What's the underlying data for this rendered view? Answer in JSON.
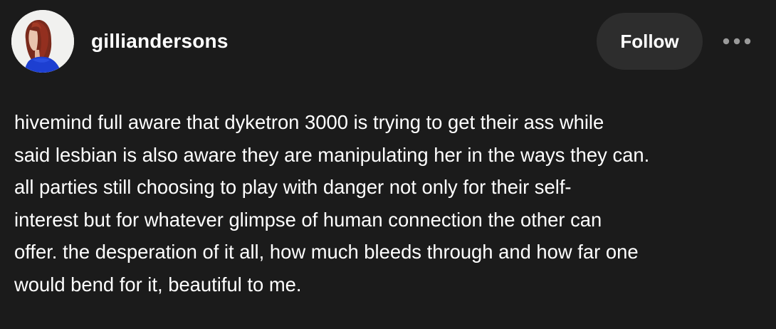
{
  "post": {
    "username": "gilliandersons",
    "follow_label": "Follow",
    "more_icon": "ellipsis-horizontal-icon",
    "avatar_icon": "profile-avatar",
    "body_lines": [
      "hivemind full aware that dyketron 3000 is trying to get their ass while",
      "said lesbian is also aware they are manipulating her in the ways they can.",
      "all parties still choosing to play with danger not only for their self-",
      "interest but for whatever glimpse of human connection the other can",
      "offer. the desperation of it all, how much bleeds through and how far one",
      "would bend for it, beautiful to me."
    ]
  },
  "colors": {
    "background": "#1b1b1b",
    "button_bg": "#2d2d2d",
    "text": "#ffffff",
    "icon": "#9a9a9a"
  }
}
